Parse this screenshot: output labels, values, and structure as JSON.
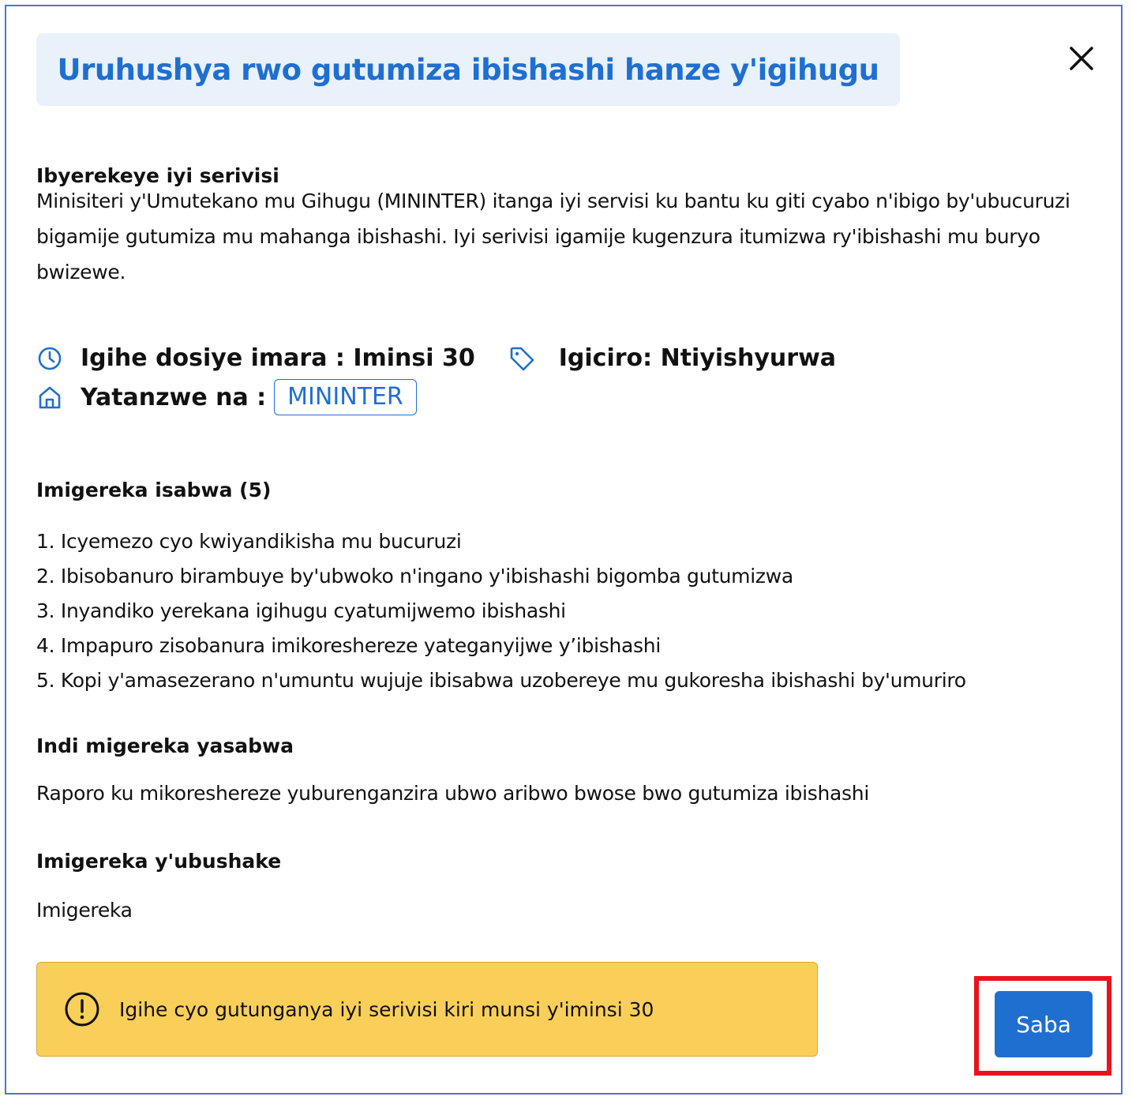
{
  "modal": {
    "title": "Uruhushya rwo gutumiza ibishashi hanze y'igihugu"
  },
  "about": {
    "heading": "Ibyerekeye iyi serivisi",
    "text": "Minisiteri y'Umutekano mu Gihugu (MININTER) itanga iyi servisi ku bantu ku giti cyabo n'ibigo by'ubucuruzi bigamije gutumiza mu mahanga ibishashi. Iyi serivisi igamije kugenzura itumizwa ry'ibishashi mu buryo bwizewe."
  },
  "meta": {
    "processing_time": "Igihe dosiye imara : Iminsi 30",
    "price": "Igiciro: Ntiyishyurwa",
    "provided_by_label": "Yatanzwe na :",
    "agency": "MININTER"
  },
  "requirements": {
    "heading": "Imigereka isabwa (5)",
    "items": [
      "1. Icyemezo cyo kwiyandikisha mu bucuruzi",
      "2. Ibisobanuro birambuye by'ubwoko n'ingano y'ibishashi bigomba gutumizwa",
      "3. Inyandiko yerekana igihugu cyatumijwemo ibishashi",
      "4. Impapuro zisobanura imikoreshereze yateganyijwe y’ibishashi",
      "5. Kopi y'amasezerano n'umuntu wujuje ibisabwa uzobereye mu gukoresha ibishashi by'umuriro"
    ]
  },
  "other_requirements": {
    "heading": "Indi migereka yasabwa",
    "text": "Raporo ku mikoreshereze yuburenganzira ubwo aribwo bwose bwo gutumiza ibishashi"
  },
  "optional_attachments": {
    "heading": "Imigereka y'ubushake",
    "text": "Imigereka"
  },
  "warning": {
    "text": "Igihe cyo gutunganya iyi serivisi kiri munsi y'iminsi 30"
  },
  "actions": {
    "apply_label": "Saba"
  },
  "colors": {
    "primary": "#1f6fd1",
    "title_bg": "#e9f1fb",
    "warning_bg": "#f9cf5a",
    "highlight": "#e8141b"
  },
  "icons": {
    "close": "close-icon",
    "clock": "clock-icon",
    "tag": "tag-icon",
    "home": "home-icon",
    "alert": "alert-circle-icon"
  }
}
